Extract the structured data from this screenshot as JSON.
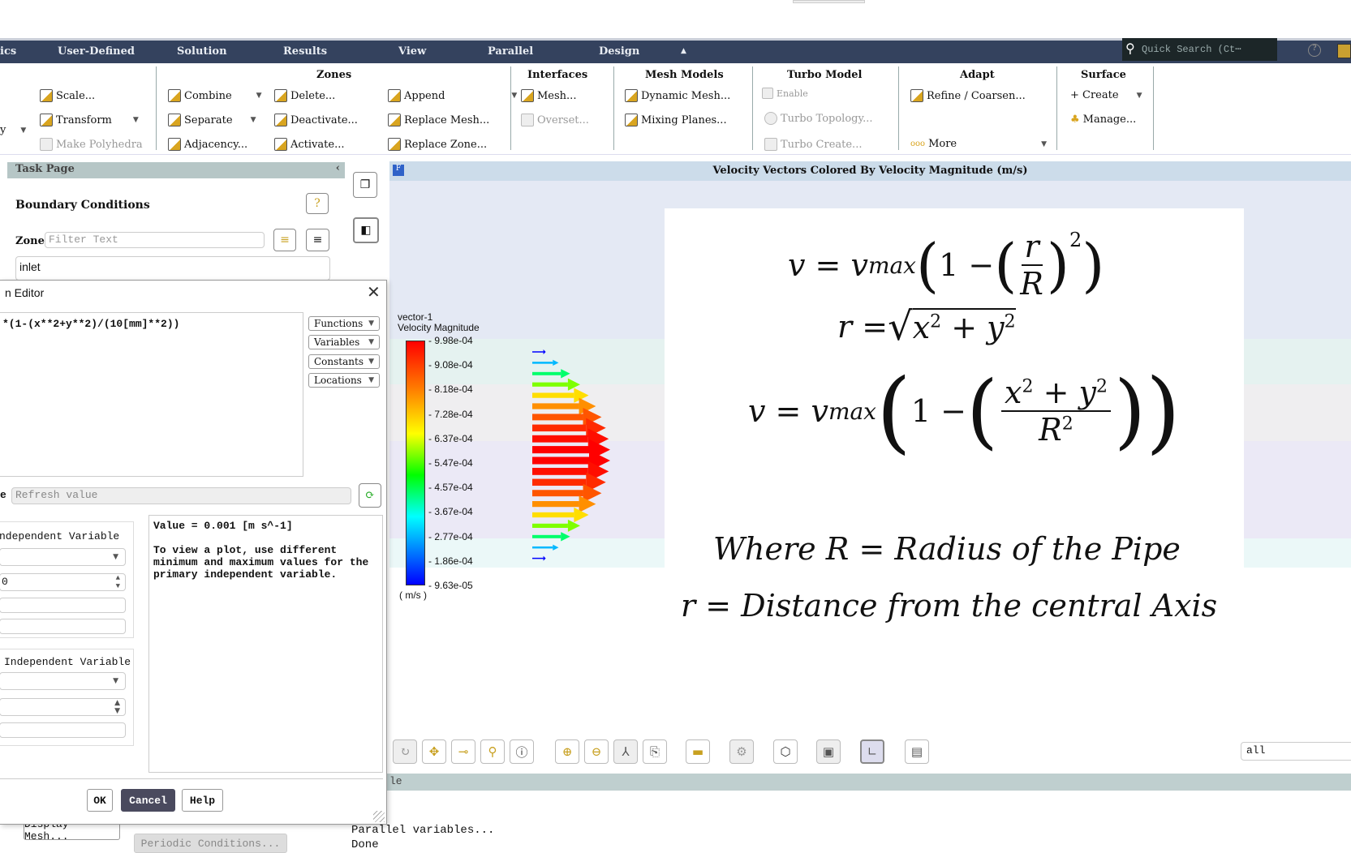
{
  "menubar": {
    "items": [
      "ics",
      "User-Defined",
      "Solution",
      "Results",
      "View",
      "Parallel",
      "Design"
    ],
    "collapse_icon": "triangle-up",
    "search_placeholder": "Quick Search (Ct⋯"
  },
  "ribbon": {
    "left": {
      "scale": "Scale...",
      "transform": "Transform",
      "make_polyhedra": "Make Polyhedra",
      "partial": "y"
    },
    "zones": {
      "title": "Zones",
      "combine": "Combine",
      "separate": "Separate",
      "adjacency": "Adjacency...",
      "delete": "Delete...",
      "deactivate": "Deactivate...",
      "activate": "Activate...",
      "append": "Append",
      "replace_mesh": "Replace Mesh...",
      "replace_zone": "Replace Zone..."
    },
    "interfaces": {
      "title": "Interfaces",
      "mesh": "Mesh...",
      "overset": "Overset..."
    },
    "mesh_models": {
      "title": "Mesh Models",
      "dynamic_mesh": "Dynamic Mesh...",
      "mixing_planes": "Mixing Planes..."
    },
    "turbo_model": {
      "title": "Turbo Model",
      "enable": "Enable",
      "turbo_topology": "Turbo Topology...",
      "turbo_create": "Turbo Create..."
    },
    "adapt": {
      "title": "Adapt",
      "refine": "Refine / Coarsen...",
      "more": "More"
    },
    "surface": {
      "title": "Surface",
      "create": "+ Create",
      "manage": "Manage..."
    }
  },
  "task_page": {
    "header": "Task Page",
    "title": "Boundary Conditions",
    "zone_label": "Zone",
    "filter_placeholder": "Filter Text",
    "selected_zone": "inlet"
  },
  "graphics": {
    "title": "Velocity Vectors Colored By Velocity Magnitude (m/s)",
    "colorbar": {
      "name": "vector-1",
      "quantity": "Velocity Magnitude",
      "unit": "( m/s )",
      "ticks": [
        "9.98e-04",
        "9.08e-04",
        "8.18e-04",
        "7.28e-04",
        "6.37e-04",
        "5.47e-04",
        "4.57e-04",
        "3.67e-04",
        "2.77e-04",
        "1.86e-04",
        "9.63e-05"
      ],
      "min": 9.63e-05,
      "max": 0.000998,
      "colormap": "jet"
    },
    "vectors_m_per_s": [
      9.75e-05,
      0.000278,
      0.000438,
      0.000578,
      0.000698,
      0.000798,
      0.000878,
      0.000938,
      0.000978,
      0.000998,
      0.000998,
      0.000978,
      0.000938,
      0.000878,
      0.000798,
      0.000698,
      0.000578,
      0.000438,
      0.000278,
      9.75e-05
    ],
    "equations": {
      "eq1_lhs": "v = v",
      "eq1_sub": "max",
      "eq2": "r = ",
      "eq3_lhs": "v = v",
      "where1": "Where R =  Radius of the Pipe",
      "where2": "r = Distance from the central Axis"
    },
    "view_select": "all"
  },
  "dialog": {
    "title": "n Editor",
    "expression": "*(1-(x**2+y**2)/(10[mm]**2))",
    "buttons": [
      "Functions",
      "Variables",
      "Constants",
      "Locations"
    ],
    "value_label": "e",
    "refresh_placeholder": "Refresh value",
    "group1_label": "ndependent Variable",
    "group1_spin": "0",
    "group2_label": "Independent Variable",
    "value_text": "Value =   0.001 [m s^-1]",
    "hint": "To view a plot, use different minimum and maximum values for the primary independent variable.",
    "ok": "OK",
    "cancel": "Cancel",
    "help": "Help"
  },
  "bottom": {
    "display_mesh": "Display Mesh...",
    "periodic": "Periodic Conditions...",
    "console_header": "le",
    "console_line": "Parallel variables...",
    "console_line2": "Done"
  },
  "colors": {
    "menubar": "#34425e",
    "cancel": "#4a4a5e",
    "accent": "#d9a520"
  }
}
